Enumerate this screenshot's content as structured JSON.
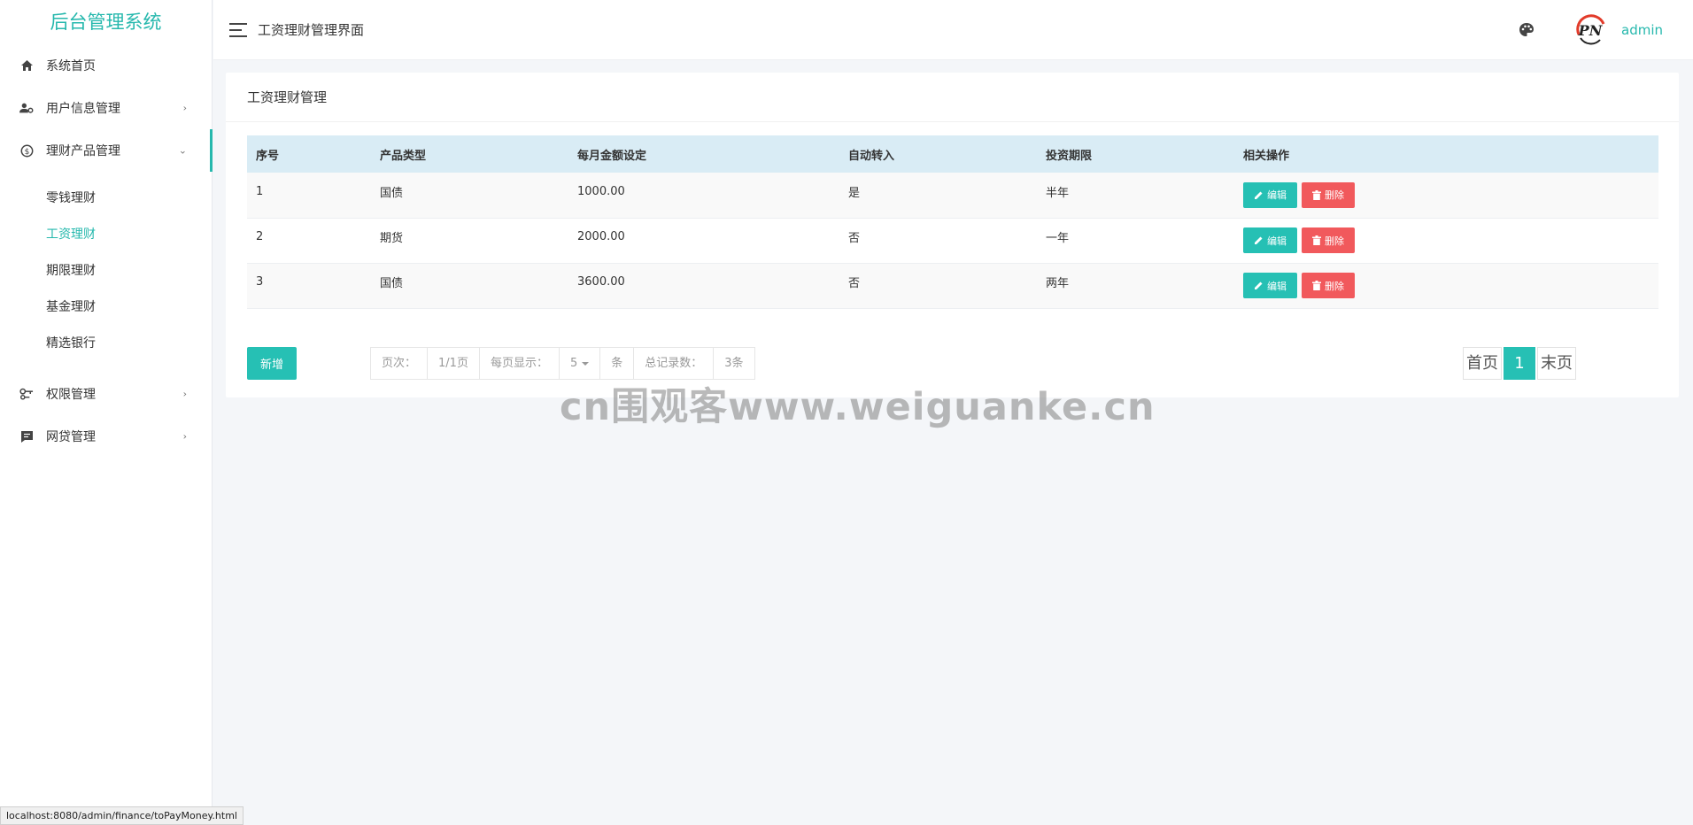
{
  "sidebar": {
    "brand": "后台管理系统",
    "items": [
      {
        "label": "系统首页"
      },
      {
        "label": "用户信息管理"
      },
      {
        "label": "理财产品管理"
      },
      {
        "label": "权限管理"
      },
      {
        "label": "网贷管理"
      }
    ],
    "sub_items": [
      {
        "label": "零钱理财"
      },
      {
        "label": "工资理财"
      },
      {
        "label": "期限理财"
      },
      {
        "label": "基金理财"
      },
      {
        "label": "精选银行"
      }
    ]
  },
  "header": {
    "title": "工资理财管理界面",
    "username": "admin"
  },
  "card": {
    "title": "工资理财管理",
    "columns": [
      "序号",
      "产品类型",
      "每月金额设定",
      "自动转入",
      "投资期限",
      "相关操作"
    ],
    "rows": [
      {
        "id": "1",
        "type": "国债",
        "amount": "1000.00",
        "auto": "是",
        "term": "半年"
      },
      {
        "id": "2",
        "type": "期货",
        "amount": "2000.00",
        "auto": "否",
        "term": "一年"
      },
      {
        "id": "3",
        "type": "国债",
        "amount": "3600.00",
        "auto": "否",
        "term": "两年"
      }
    ],
    "edit_label": "编辑",
    "delete_label": "删除",
    "add_label": "新增"
  },
  "pager": {
    "page_label": "页次：",
    "page_value": "1/1页",
    "per_page_label": "每页显示：",
    "per_page_value": "5",
    "per_page_unit": "条",
    "total_label": "总记录数：",
    "total_value": "3条",
    "first": "首页",
    "current": "1",
    "last": "末页"
  },
  "watermark": "cn围观客www.weiguanke.cn",
  "status_url": "localhost:8080/admin/finance/toPayMoney.html",
  "colors": {
    "accent": "#26c0b4",
    "danger": "#f1595c",
    "table_header": "#d9ecf5"
  }
}
